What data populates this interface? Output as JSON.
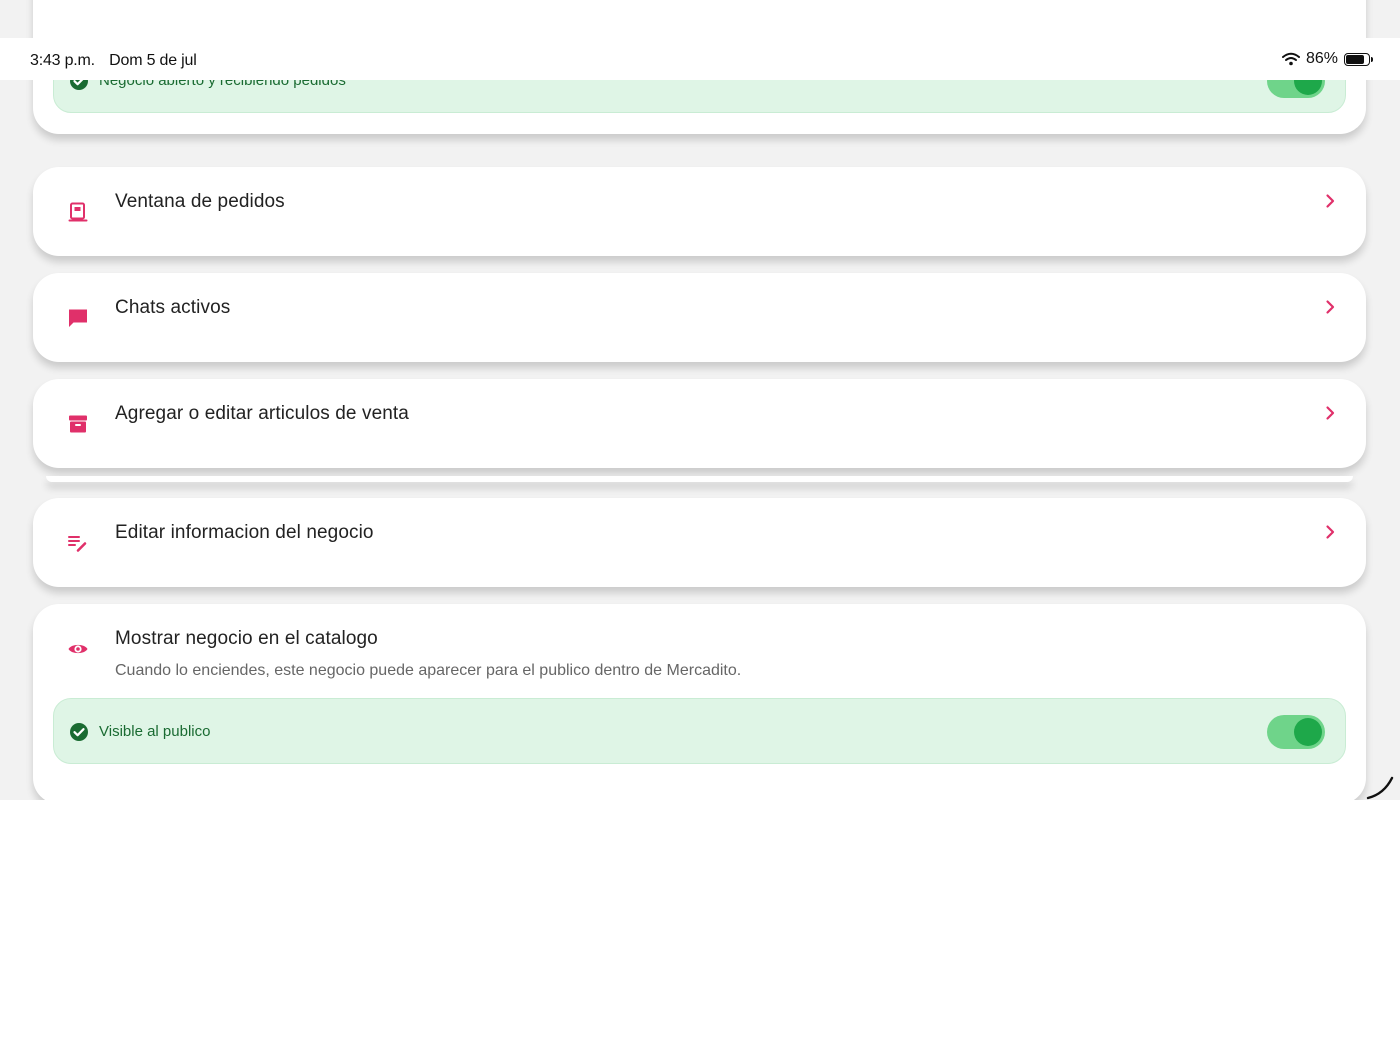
{
  "status_bar": {
    "time": "3:43 p.m.",
    "date": "Dom 5 de jul",
    "battery": "86%",
    "battery_level": 0.86
  },
  "business_status": {
    "text": "Negocio abierto y recibiendo pedidos",
    "toggle_on": true
  },
  "menu": {
    "orders_window": "Ventana de pedidos",
    "active_chats": "Chats activos",
    "edit_items": "Agregar o editar articulos de venta",
    "edit_business_info": "Editar informacion del negocio"
  },
  "catalog": {
    "title": "Mostrar negocio en el catalogo",
    "description": "Cuando lo enciendes, este negocio puede aparecer para el publico dentro de Mercadito.",
    "status_text": "Visible al publico",
    "toggle_on": true
  },
  "colors": {
    "accent": "#e0306a",
    "success": "#1ea84a",
    "success_bg": "#dff5e6"
  }
}
